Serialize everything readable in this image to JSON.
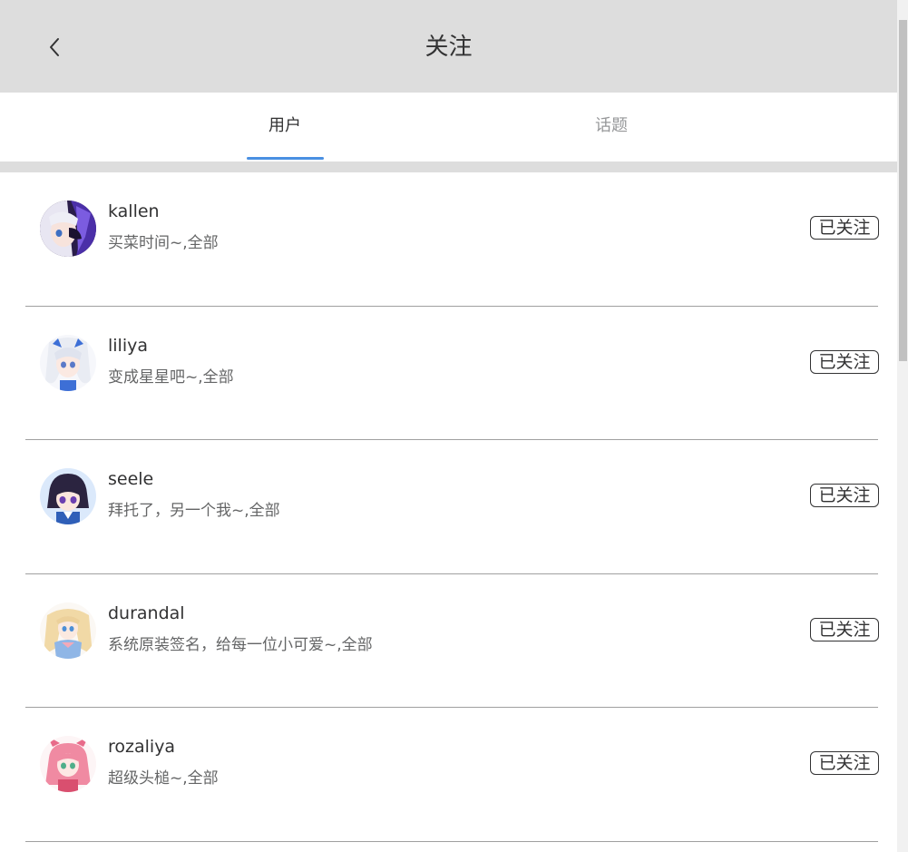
{
  "header": {
    "title": "关注",
    "back_icon": "chevron-left-icon"
  },
  "tabs": [
    {
      "label": "用户",
      "active": true
    },
    {
      "label": "话题",
      "active": false
    }
  ],
  "accent_color": "#4a90e2",
  "users": [
    {
      "name": "kallen",
      "signature": "买菜时间~,全部",
      "follow_label": "已关注"
    },
    {
      "name": "liliya",
      "signature": "变成星星吧~,全部",
      "follow_label": "已关注"
    },
    {
      "name": "seele",
      "signature": "拜托了，另一个我~,全部",
      "follow_label": "已关注"
    },
    {
      "name": "durandal",
      "signature": "系统原装签名，给每一位小可爱~,全部",
      "follow_label": "已关注"
    },
    {
      "name": "rozaliya",
      "signature": "超级头槌~,全部",
      "follow_label": "已关注"
    }
  ]
}
